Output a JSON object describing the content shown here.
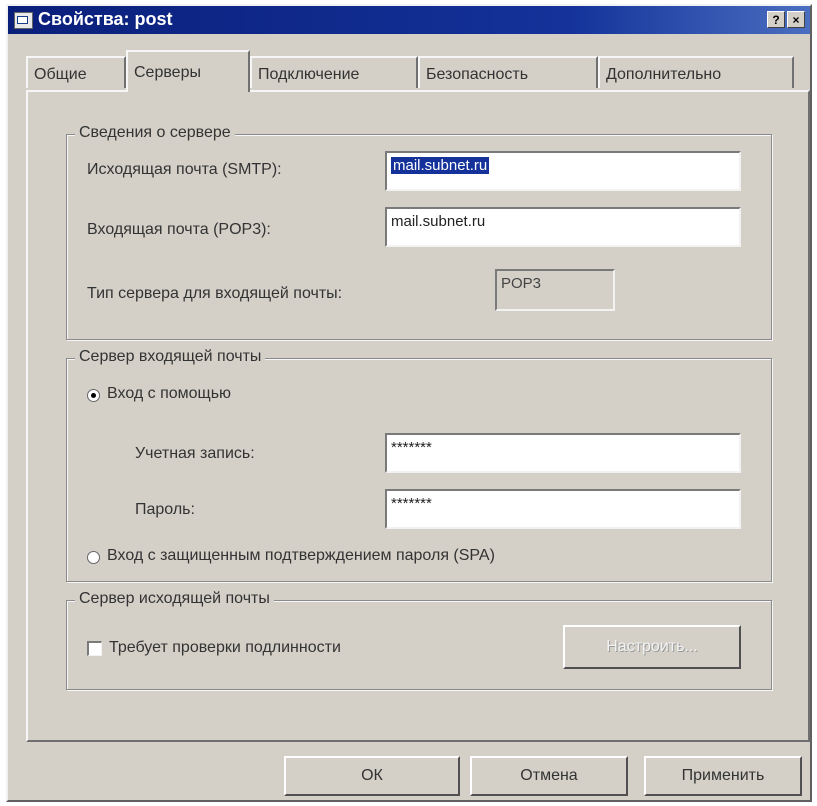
{
  "window": {
    "title": "Свойства: post",
    "help_label": "?",
    "close_label": "×"
  },
  "tabs": [
    "Общие",
    "Серверы",
    "Подключение",
    "Безопасность",
    "Дополнительно"
  ],
  "server_info": {
    "legend": "Сведения о сервере",
    "smtp_label": "Исходящая почта (SMTP):",
    "smtp_value": "mail.subnet.ru",
    "pop3_label": "Входящая почта (POP3):",
    "pop3_value": "mail.subnet.ru",
    "type_label": "Тип сервера для входящей почты:",
    "type_value": "POP3"
  },
  "incoming": {
    "legend": "Сервер входящей почты",
    "login_with_label": "Вход с помощью",
    "account_label": "Учетная запись:",
    "account_value": "*******",
    "password_label": "Пароль:",
    "password_value": "*******",
    "spa_label": "Вход с защищенным подтверждением пароля (SPA)"
  },
  "outgoing": {
    "legend": "Сервер исходящей почты",
    "auth_label": "Требует проверки подлинности",
    "settings_label": "Настроить..."
  },
  "buttons": {
    "ok": "ОК",
    "cancel": "Отмена",
    "apply": "Применить"
  }
}
